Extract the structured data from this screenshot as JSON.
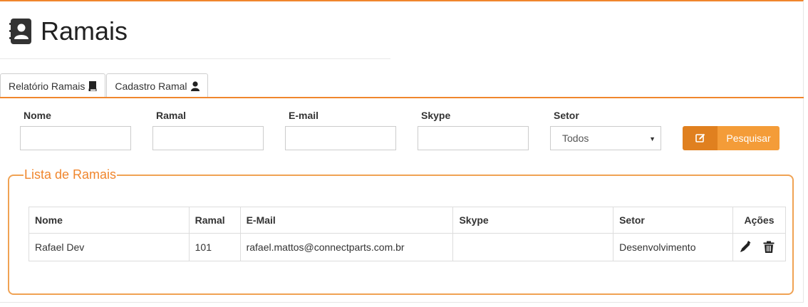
{
  "header": {
    "title": "Ramais",
    "icon": "address-book-icon"
  },
  "tabs": [
    {
      "label": "Relatório Ramais",
      "icon": "book-icon"
    },
    {
      "label": "Cadastro Ramal",
      "icon": "user-icon"
    }
  ],
  "filters": {
    "nome_label": "Nome",
    "nome_value": "",
    "ramal_label": "Ramal",
    "ramal_value": "",
    "email_label": "E-mail",
    "email_value": "",
    "skype_label": "Skype",
    "skype_value": "",
    "setor_label": "Setor",
    "setor_selected": "Todos"
  },
  "search_button": {
    "label": "Pesquisar",
    "icon": "edit-icon"
  },
  "list": {
    "legend": "Lista de Ramais",
    "columns": [
      "Nome",
      "Ramal",
      "E-Mail",
      "Skype",
      "Setor",
      "Ações"
    ],
    "rows": [
      {
        "nome": "Rafael Dev",
        "ramal": "101",
        "email": "rafael.mattos@connectparts.com.br",
        "skype": "",
        "setor": "Desenvolvimento"
      }
    ]
  },
  "colors": {
    "accent": "#f0862d",
    "button_dark": "#e0801f",
    "button_light": "#f49c38",
    "fieldset_border": "#f0a253"
  }
}
